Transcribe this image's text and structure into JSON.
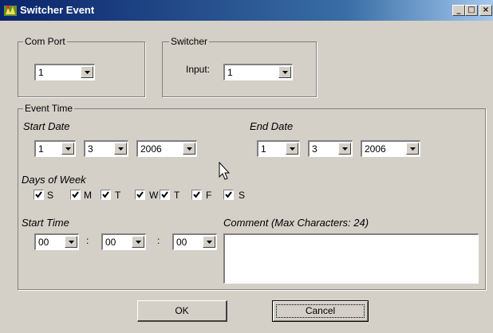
{
  "window": {
    "title": "Switcher Event"
  },
  "title_buttons": {
    "minimize": "_",
    "maximize": "□",
    "close": "×"
  },
  "com_port": {
    "label": "Com Port",
    "value": "1"
  },
  "switcher": {
    "label": "Switcher",
    "input_label": "Input:",
    "input_value": "1"
  },
  "event_time": {
    "label": "Event Time",
    "start_date": {
      "label": "Start Date",
      "day": "1",
      "month": "3",
      "year": "2006"
    },
    "end_date": {
      "label": "End Date",
      "day": "1",
      "month": "3",
      "year": "2006"
    },
    "days_label": "Days of Week",
    "days": [
      {
        "label": "S",
        "checked": true
      },
      {
        "label": "M",
        "checked": true
      },
      {
        "label": "T",
        "checked": true
      },
      {
        "label": "W",
        "checked": true
      },
      {
        "label": "T",
        "checked": true
      },
      {
        "label": "F",
        "checked": true
      },
      {
        "label": "S",
        "checked": true
      }
    ],
    "start_time": {
      "label": "Start Time",
      "hour": "00",
      "minute": "00",
      "second": "00",
      "separator": ":"
    },
    "comment": {
      "label": "Comment (Max Characters: 24)",
      "value": ""
    }
  },
  "buttons": {
    "ok": "OK",
    "cancel": "Cancel"
  }
}
